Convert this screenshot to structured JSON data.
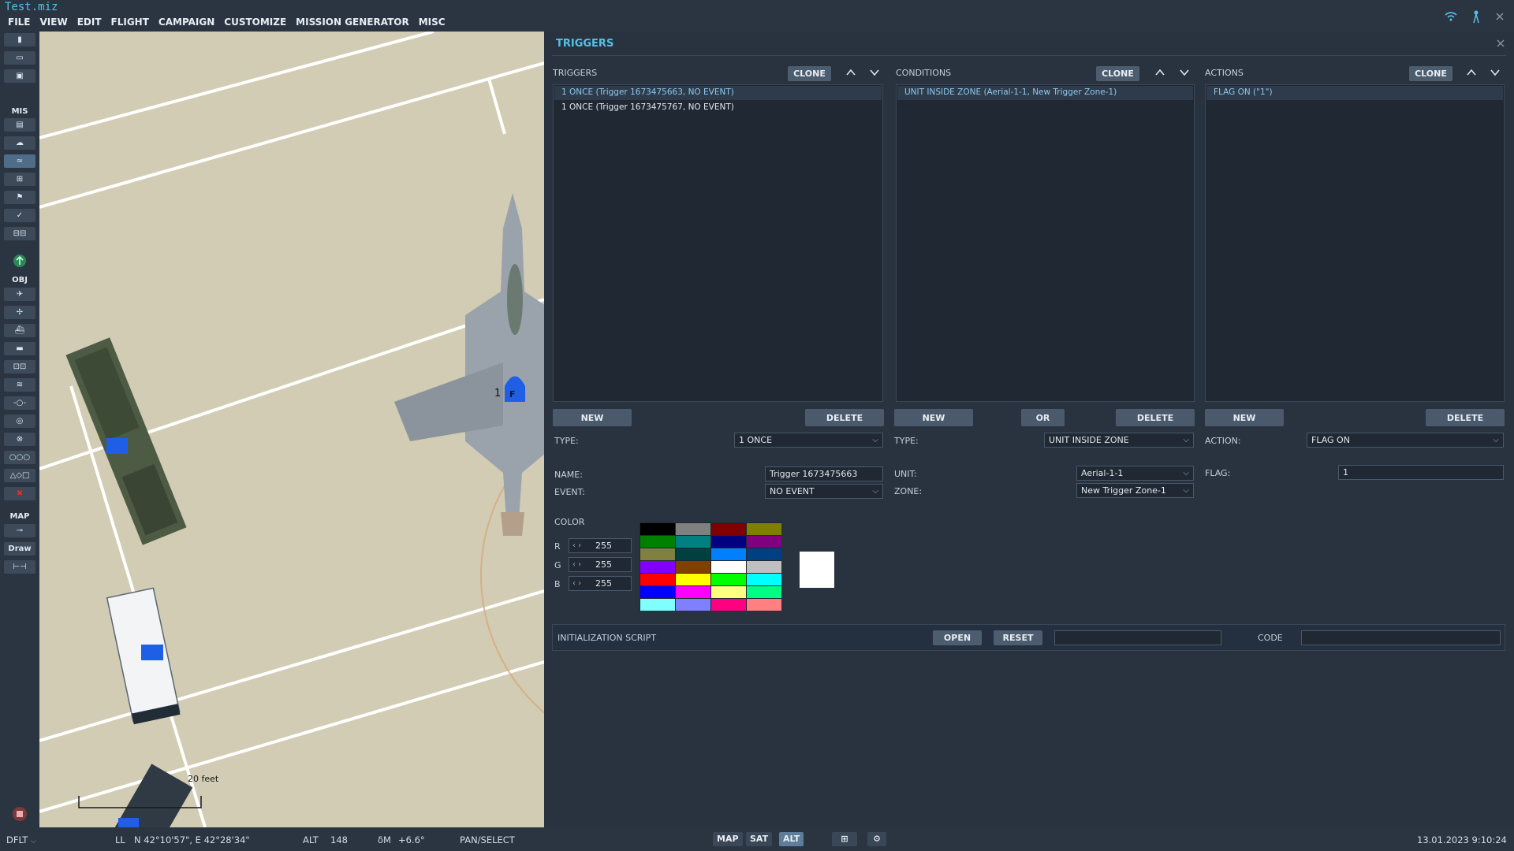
{
  "app": {
    "file_title": "Test.miz",
    "menu": [
      "FILE",
      "VIEW",
      "EDIT",
      "FLIGHT",
      "CAMPAIGN",
      "CUSTOMIZE",
      "MISSION GENERATOR",
      "MISC"
    ]
  },
  "toolbar": {
    "sections": {
      "mis": "MIS",
      "obj": "OBJ",
      "map": "MAP"
    },
    "draw_label": "Draw"
  },
  "map": {
    "scale_label": "20 feet",
    "unit_number": "1",
    "unit_letter": "F"
  },
  "triggers": {
    "panel_title": "TRIGGERS",
    "clone_label": "CLONE",
    "new_label": "NEW",
    "delete_label": "DELETE",
    "or_label": "OR",
    "columns": {
      "triggers": "TRIGGERS",
      "conditions": "CONDITIONS",
      "actions": "ACTIONS"
    },
    "trigger_list": [
      "1 ONCE (Trigger 1673475663, NO EVENT)",
      "1 ONCE (Trigger 1673475767, NO EVENT)"
    ],
    "condition_list": [
      "UNIT INSIDE ZONE (Aerial-1-1, New Trigger Zone-1)"
    ],
    "action_list": [
      "FLAG ON (\"1\")"
    ],
    "trigger_props": {
      "type_label": "TYPE:",
      "type_value": "1 ONCE",
      "name_label": "NAME:",
      "name_value": "Trigger 1673475663",
      "event_label": "EVENT:",
      "event_value": "NO EVENT"
    },
    "condition_props": {
      "type_label": "TYPE:",
      "type_value": "UNIT INSIDE ZONE",
      "unit_label": "UNIT:",
      "unit_value": "Aerial-1-1",
      "zone_label": "ZONE:",
      "zone_value": "New Trigger Zone-1"
    },
    "action_props": {
      "action_label": "ACTION:",
      "action_value": "FLAG ON",
      "flag_label": "FLAG:",
      "flag_value": "1"
    },
    "color": {
      "label": "COLOR",
      "r_label": "R",
      "r_value": "255",
      "g_label": "G",
      "g_value": "255",
      "b_label": "B",
      "b_value": "255",
      "preview": "#ffffff",
      "palette": [
        "#000000",
        "#808080",
        "#800000",
        "#808000",
        "#008000",
        "#008080",
        "#000080",
        "#800080",
        "#808040",
        "#004040",
        "#0080ff",
        "#004080",
        "#8000ff",
        "#804000",
        "#ffffff",
        "#c0c0c0",
        "#ff0000",
        "#ffff00",
        "#00ff00",
        "#00ffff",
        "#0000ff",
        "#ff00ff",
        "#ffff80",
        "#00ff80",
        "#80ffff",
        "#8080ff",
        "#ff0080",
        "#ff8080"
      ]
    },
    "init_script": {
      "label": "INITIALIZATION SCRIPT",
      "open_label": "OPEN",
      "reset_label": "RESET",
      "code_label": "CODE"
    }
  },
  "status": {
    "profile": "DFLT",
    "ll_label": "LL",
    "coords": "N 42°10'57\", E 42°28'34\"",
    "alt_label": "ALT",
    "alt_value": "148",
    "magvar_label": "δM",
    "magvar_value": "+6.6°",
    "mode": "PAN/SELECT",
    "map_buttons": [
      "MAP",
      "SAT",
      "ALT"
    ],
    "datetime": "13.01.2023 9:10:24"
  },
  "colors": {
    "accent": "#55c1e8",
    "panel_bg": "#293340",
    "list_bg": "#1f2833",
    "button_bg": "#4a5a6c"
  }
}
